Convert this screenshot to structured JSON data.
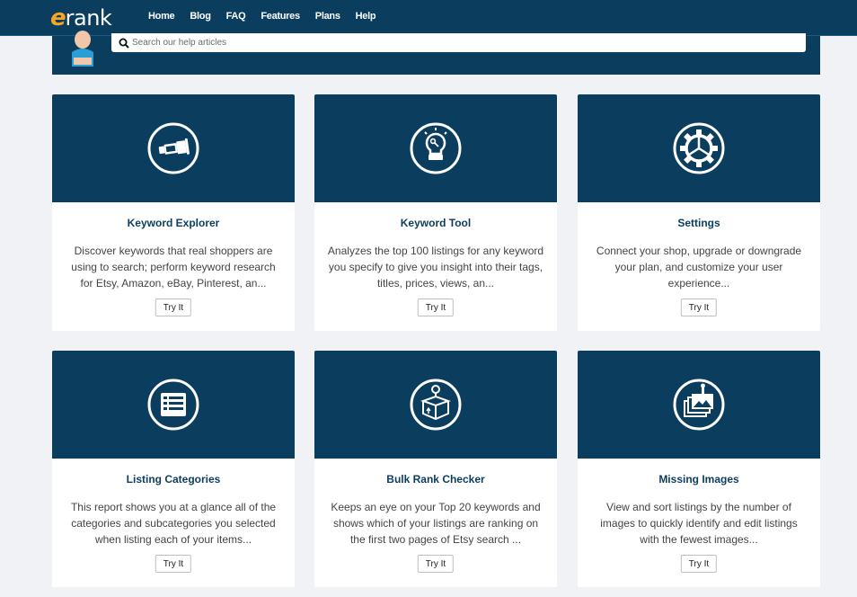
{
  "brand": {
    "logo_e": "e",
    "logo_rest": "rank"
  },
  "nav": {
    "items": [
      {
        "label": "Home"
      },
      {
        "label": "Blog"
      },
      {
        "label": "FAQ"
      },
      {
        "label": "Features"
      },
      {
        "label": "Plans"
      },
      {
        "label": "Help"
      }
    ]
  },
  "search": {
    "placeholder": "Search our help articles",
    "value": ""
  },
  "colors": {
    "navy": "#0b3d5e",
    "accent": "#f5a623",
    "background": "#f0f2f5"
  },
  "cards": [
    {
      "icon": "telescope-icon",
      "title": "Keyword Explorer",
      "desc": "Discover keywords that real shoppers are using to search; perform keyword research for Etsy, Amazon, eBay, Pinterest, an...",
      "button": "Try It"
    },
    {
      "icon": "lightbulb-icon",
      "title": "Keyword Tool",
      "desc": "Analyzes the top 100 listings for any keyword you specify to give you insight into their tags, titles, prices, views, an...",
      "button": "Try It"
    },
    {
      "icon": "gear-icon",
      "title": "Settings",
      "desc": "Connect your shop, upgrade or downgrade your plan, and customize your user experience...",
      "button": "Try It"
    },
    {
      "icon": "list-icon",
      "title": "Listing Categories",
      "desc": "This report shows you at a glance all of the categories and subcategories you selected when listing each of your items...",
      "button": "Try It"
    },
    {
      "icon": "box-search-icon",
      "title": "Bulk Rank Checker",
      "desc": "Keeps an eye on your Top 20 keywords and shows which of your listings are ranking on the first two pages of Etsy search ...",
      "button": "Try It"
    },
    {
      "icon": "images-icon",
      "title": "Missing Images",
      "desc": "View and sort listings by the number of images to quickly identify and edit listings with the fewest images...",
      "button": "Try It"
    }
  ]
}
